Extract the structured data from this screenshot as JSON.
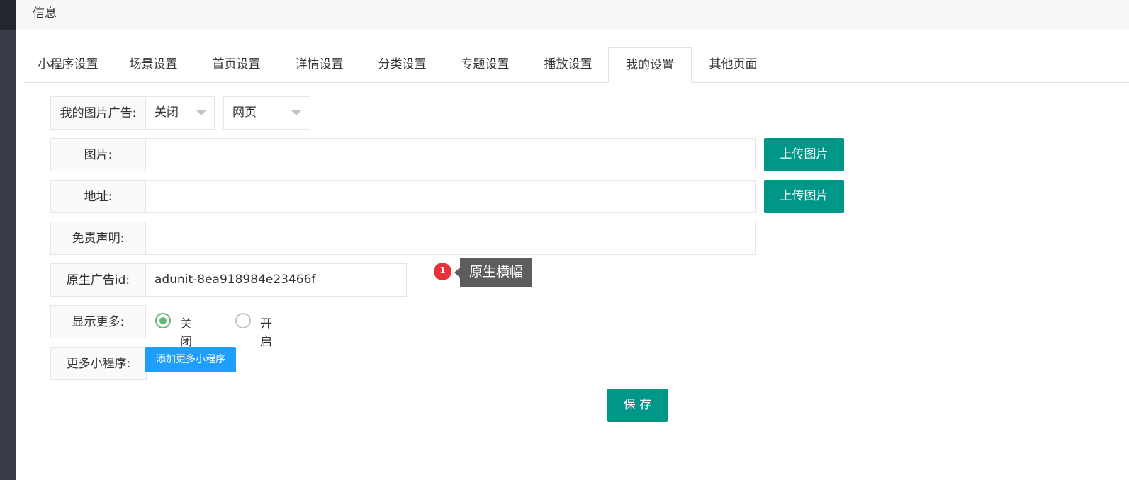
{
  "header": {
    "title": "信息"
  },
  "tabs": [
    {
      "label": "小程序设置"
    },
    {
      "label": "场景设置"
    },
    {
      "label": "首页设置"
    },
    {
      "label": "详情设置"
    },
    {
      "label": "分类设置"
    },
    {
      "label": "专题设置"
    },
    {
      "label": "播放设置"
    },
    {
      "label": "我的设置",
      "active": true
    },
    {
      "label": "其他页面"
    }
  ],
  "form": {
    "ad": {
      "label": "我的图片广告:",
      "status_value": "关闭",
      "type_value": "网页"
    },
    "image": {
      "label": "图片:",
      "value": "",
      "button": "上传图片"
    },
    "address": {
      "label": "地址:",
      "value": "",
      "button": "上传图片"
    },
    "disclaimer": {
      "label": "免责声明:",
      "value": ""
    },
    "native_ad": {
      "label": "原生广告id:",
      "value": "adunit-8ea918984e23466f"
    },
    "show_more": {
      "label": "显示更多:",
      "options": [
        "关闭",
        "开启"
      ],
      "selected": "关闭"
    },
    "more_apps": {
      "label": "更多小程序:",
      "button": "添加更多小程序"
    },
    "save_button": "保 存"
  },
  "annotation": {
    "badge": "1",
    "tooltip": "原生横幅"
  },
  "colors": {
    "primary": "#009688",
    "blue": "#1e9fff",
    "radio_on": "#5fb878",
    "badge": "#e8313a"
  }
}
